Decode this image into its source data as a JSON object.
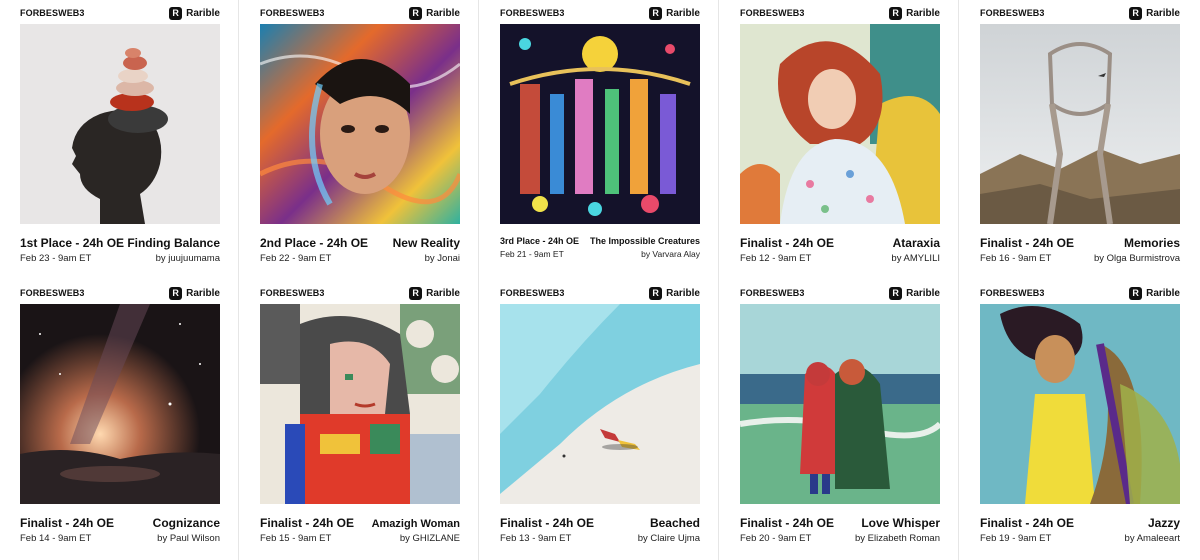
{
  "brand": "FORBESWEB3",
  "platform": "Rarible",
  "platform_icon": "R",
  "cards": [
    {
      "place": "1st Place - 24h OE",
      "title": "Finding Balance",
      "date": "Feb 23 - 9am ET",
      "by": "by juujuumama"
    },
    {
      "place": "2nd Place - 24h OE",
      "title": "New Reality",
      "date": "Feb 22 - 9am ET",
      "by": "by Jonai"
    },
    {
      "place": "3rd Place - 24h OE",
      "title": "The Impossible Creatures",
      "date": "Feb 21 - 9am ET",
      "by": "by Varvara Alay"
    },
    {
      "place": "Finalist - 24h OE",
      "title": "Ataraxia",
      "date": "Feb 12 - 9am ET",
      "by": "by AMYLILI"
    },
    {
      "place": "Finalist - 24h OE",
      "title": "Memories",
      "date": "Feb 16 - 9am ET",
      "by": "by Olga Burmistrova"
    },
    {
      "place": "Finalist - 24h OE",
      "title": "Cognizance",
      "date": "Feb 14 - 9am ET",
      "by": "by Paul Wilson"
    },
    {
      "place": "Finalist - 24h OE",
      "title": "Amazigh Woman",
      "date": "Feb 15 - 9am ET",
      "by": "by GHIZLANE"
    },
    {
      "place": "Finalist - 24h OE",
      "title": "Beached",
      "date": "Feb 13 - 9am ET",
      "by": "by Claire Ujma"
    },
    {
      "place": "Finalist - 24h OE",
      "title": "Love Whisper",
      "date": "Feb 20 - 9am ET",
      "by": "by Elizabeth Roman"
    },
    {
      "place": "Finalist - 24h OE",
      "title": "Jazzy",
      "date": "Feb 19 - 9am ET",
      "by": "by Amaleeart"
    }
  ]
}
